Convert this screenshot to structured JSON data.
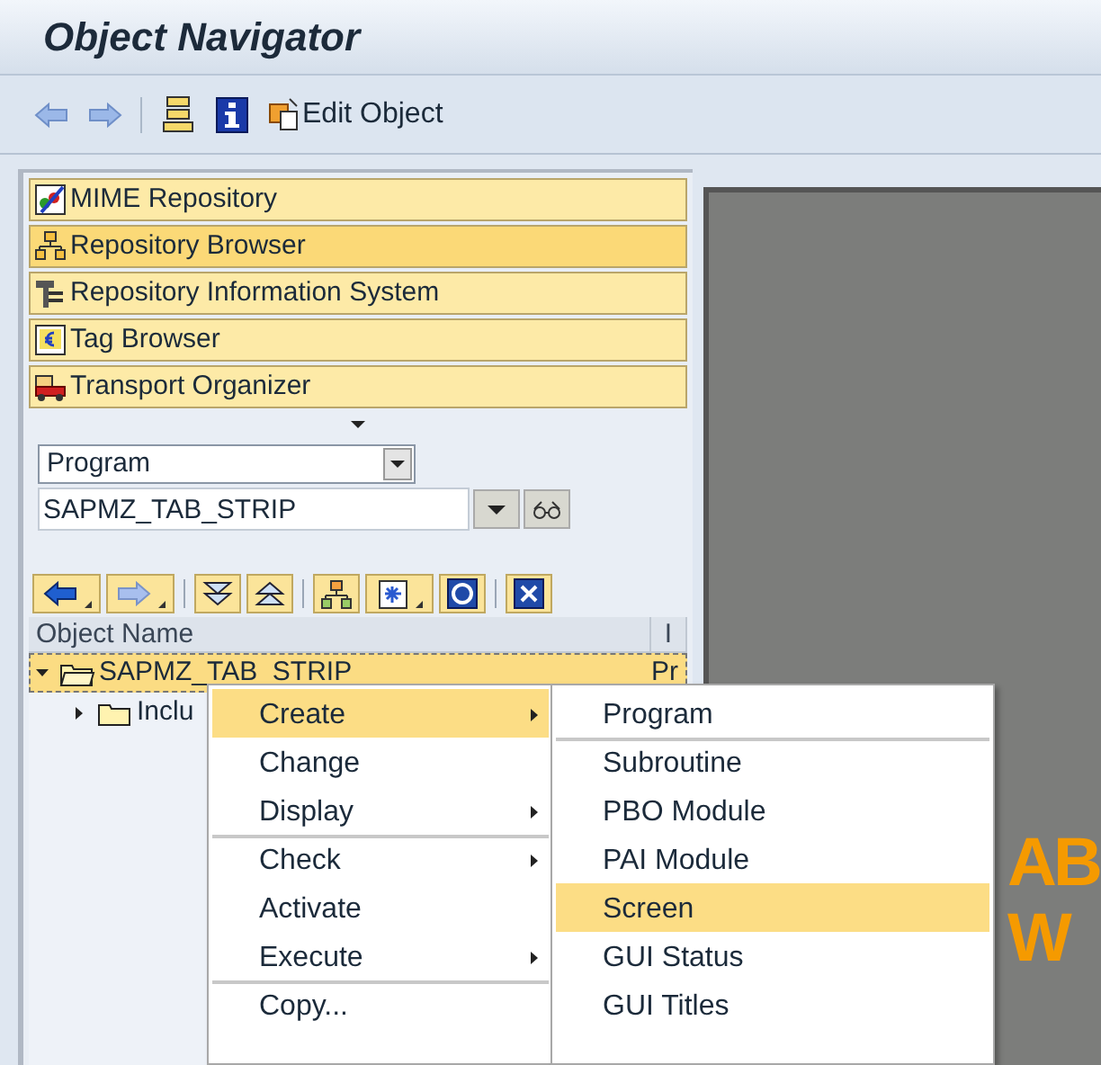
{
  "window": {
    "title": "Object Navigator"
  },
  "toolbar": {
    "edit_label": "Edit Object"
  },
  "navigator_buttons": [
    {
      "label": "MIME Repository",
      "selected": false
    },
    {
      "label": "Repository Browser",
      "selected": true
    },
    {
      "label": "Repository Information System",
      "selected": false
    },
    {
      "label": "Tag Browser",
      "selected": false
    },
    {
      "label": "Transport Organizer",
      "selected": false
    }
  ],
  "object_type": {
    "value": "Program"
  },
  "object_name": {
    "value": "SAPMZ_TAB_STRIP"
  },
  "tree": {
    "columns": [
      "Object Name",
      "I"
    ],
    "rows": [
      {
        "name": "SAPMZ_TAB_STRIP",
        "column_2": "Pr",
        "expanded": true,
        "selected": true,
        "children": [
          {
            "name": "Inclu",
            "expanded": false,
            "selected": false
          }
        ]
      }
    ]
  },
  "canvas_text": [
    "AB",
    "W"
  ],
  "context_menu": {
    "items": [
      {
        "label": "Create",
        "has_submenu": true,
        "selected": true,
        "separator_before": false
      },
      {
        "label": "Change",
        "has_submenu": false,
        "selected": false,
        "separator_before": false
      },
      {
        "label": "Display",
        "has_submenu": true,
        "selected": false,
        "separator_before": false
      },
      {
        "label": "Check",
        "has_submenu": true,
        "selected": false,
        "separator_before": true
      },
      {
        "label": "Activate",
        "has_submenu": false,
        "selected": false,
        "separator_before": false
      },
      {
        "label": "Execute",
        "has_submenu": true,
        "selected": false,
        "separator_before": false
      },
      {
        "label": "Copy...",
        "has_submenu": false,
        "selected": false,
        "separator_before": true
      }
    ]
  },
  "submenu": {
    "items": [
      {
        "label": "Program",
        "selected": false,
        "separator_before": false
      },
      {
        "label": "Subroutine",
        "selected": false,
        "separator_before": true
      },
      {
        "label": "PBO Module",
        "selected": false,
        "separator_before": false
      },
      {
        "label": "PAI Module",
        "selected": false,
        "separator_before": false
      },
      {
        "label": "Screen",
        "selected": true,
        "separator_before": false
      },
      {
        "label": "GUI Status",
        "selected": false,
        "separator_before": false
      },
      {
        "label": "GUI Titles",
        "selected": false,
        "separator_before": false
      }
    ]
  }
}
